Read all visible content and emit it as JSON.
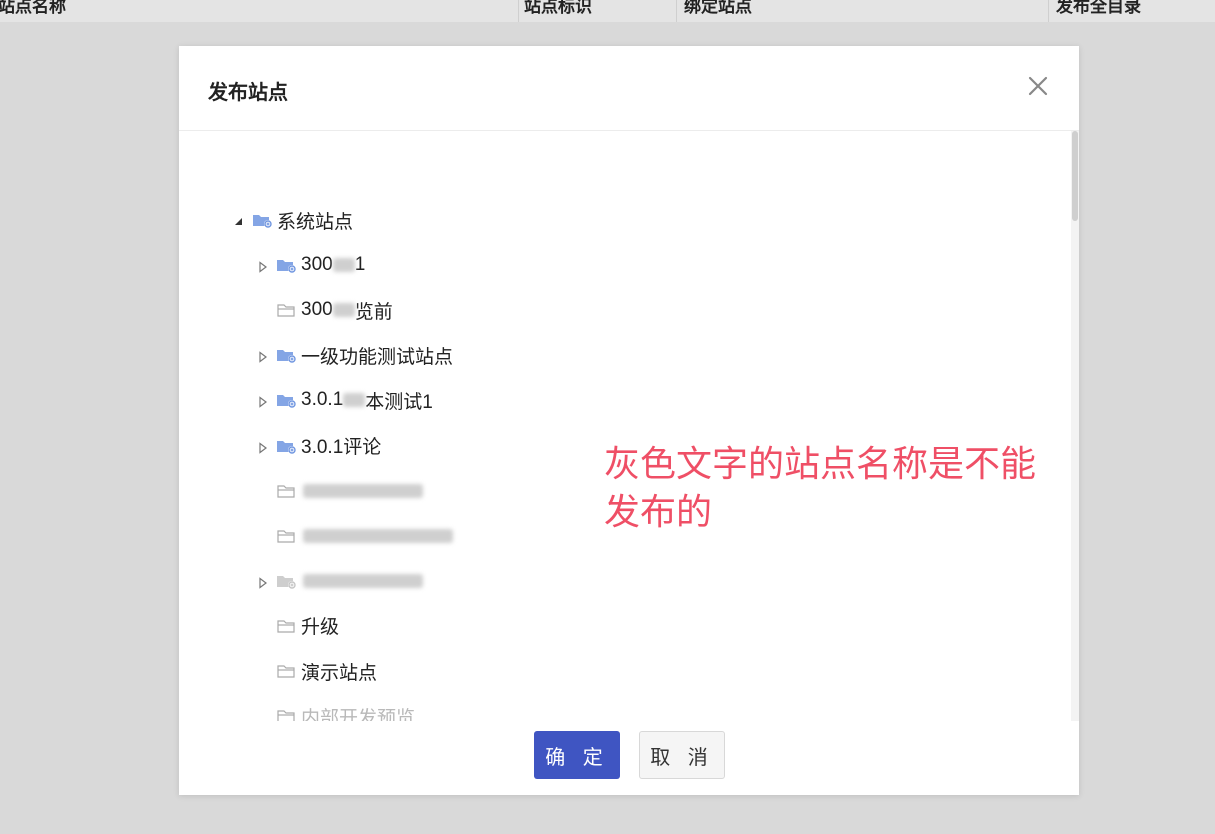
{
  "background": {
    "columns": [
      "站点名称",
      "站点标识",
      "绑定站点",
      "发布全目录"
    ]
  },
  "dialog": {
    "title": "发布站点",
    "ok_label": "确 定",
    "cancel_label": "取 消"
  },
  "tree": [
    {
      "label": "系统站点",
      "level": 0,
      "expander": "expanded",
      "icon": "site-group-icon",
      "disabled": false
    },
    {
      "label": "300",
      "suffix": "1",
      "level": 1,
      "expander": "collapsed",
      "icon": "site-group-icon",
      "disabled": false,
      "blurred": true
    },
    {
      "label": "300",
      "suffix": "览前",
      "level": 1,
      "expander": "none",
      "icon": "folder-icon",
      "disabled": false,
      "blurred": true
    },
    {
      "label": "一级功能测试站点",
      "level": 1,
      "expander": "collapsed",
      "icon": "site-group-icon",
      "disabled": false
    },
    {
      "label": "3.0.1",
      "suffix": "本测试1",
      "level": 1,
      "expander": "collapsed",
      "icon": "site-group-icon",
      "disabled": false,
      "blurred": true
    },
    {
      "label": "3.0.1评论",
      "level": 1,
      "expander": "collapsed",
      "icon": "site-group-icon",
      "disabled": false
    },
    {
      "label": "",
      "level": 1,
      "expander": "none",
      "icon": "folder-icon",
      "disabled": true,
      "blurred": true
    },
    {
      "label": "",
      "level": 1,
      "expander": "none",
      "icon": "folder-icon",
      "disabled": true,
      "blurred": true
    },
    {
      "label": "",
      "level": 1,
      "expander": "collapsed",
      "icon": "site-group-icon",
      "disabled": true,
      "blurred": true
    },
    {
      "label": "升级",
      "level": 1,
      "expander": "none",
      "icon": "folder-icon",
      "disabled": false
    },
    {
      "label": "演示站点",
      "level": 1,
      "expander": "none",
      "icon": "folder-icon",
      "disabled": false
    },
    {
      "label": "内部开发预览",
      "level": 1,
      "expander": "none",
      "icon": "folder-icon",
      "disabled": true
    }
  ],
  "annotation": {
    "line1": "灰色文字的站点名称是不能",
    "line2": "发布的"
  },
  "colors": {
    "primary": "#3f55c2",
    "annotation": "#ef4f66",
    "disabled_text": "#b9b9b9",
    "overlay": "#d9d9d9"
  }
}
